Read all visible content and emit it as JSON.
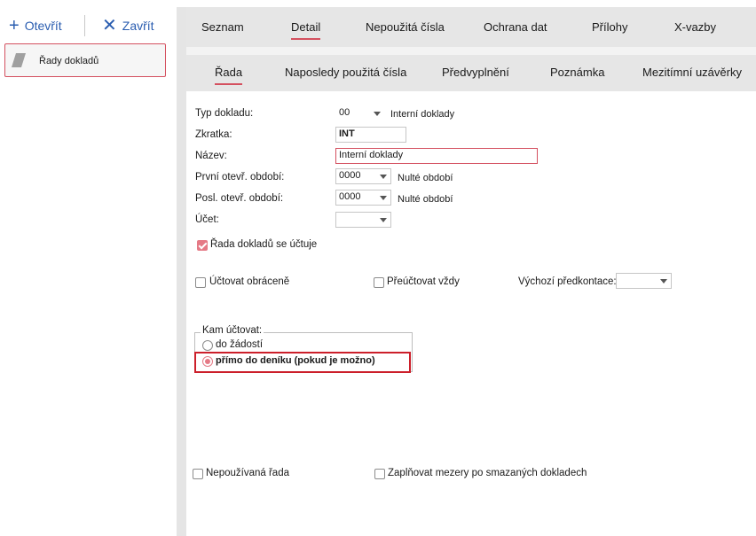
{
  "toolbar": {
    "open_label": "Otevřít",
    "close_label": "Zavřít"
  },
  "tree": {
    "item_label": "Řady dokladů"
  },
  "tabs_main": [
    "Seznam",
    "Detail",
    "Nepoužitá čísla",
    "Ochrana dat",
    "Přílohy",
    "X-vazby"
  ],
  "tabs_sub": [
    "Řada",
    "Naposledy použitá čísla",
    "Předvyplnění",
    "Poznámka",
    "Mezitímní uzávěrky"
  ],
  "form": {
    "doc_type": {
      "label": "Typ dokladu:",
      "value": "00",
      "desc": "Interní doklady"
    },
    "abbr": {
      "label": "Zkratka:",
      "value": "INT"
    },
    "name": {
      "label": "Název:",
      "value": "Interní doklady"
    },
    "first_period": {
      "label": "První otevř. období:",
      "value": "0000",
      "desc": "Nulté období"
    },
    "last_period": {
      "label": "Posl. otevř. období:",
      "value": "0000",
      "desc": "Nulté období"
    },
    "account": {
      "label": "Účet:",
      "value": ""
    },
    "series_accounted": {
      "label": "Řada dokladů se účtuje",
      "checked": true
    },
    "reverse": {
      "label": "Účtovat obráceně",
      "checked": false
    },
    "reaccount": {
      "label": "Přeúčtovat vždy",
      "checked": false
    },
    "default_prekont": {
      "label": "Výchozí předkontace:",
      "value": ""
    },
    "where_group": {
      "title": "Kam účtovat:",
      "opt1": "do žádostí",
      "opt2": "přímo do deníku (pokud je možno)",
      "selected": "opt2"
    },
    "unused_series": {
      "label": "Nepoužívaná řada",
      "checked": false
    },
    "fill_gaps": {
      "label": "Zaplňovat mezery po smazaných dokladech",
      "checked": false
    }
  },
  "colors": {
    "accent": "#d4505f",
    "link": "#2a5db0",
    "highlight": "#cc1f2a"
  }
}
